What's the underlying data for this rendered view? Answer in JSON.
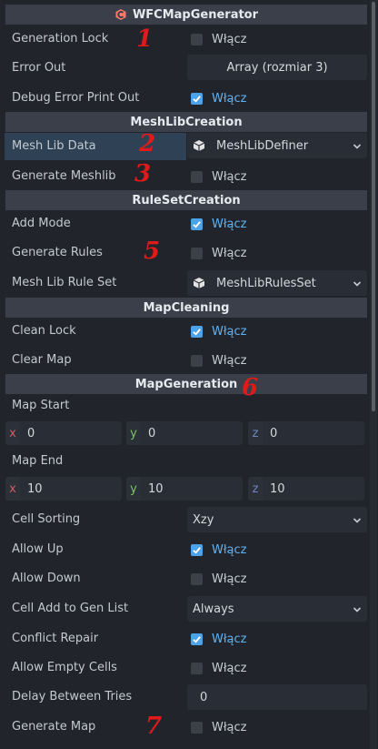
{
  "sections": {
    "main": "WFCMapGenerator",
    "meshlib": "MeshLibCreation",
    "ruleset": "RuleSetCreation",
    "mapcleaning": "MapCleaning",
    "mapgeneration": "MapGeneration"
  },
  "checkbox_text": "Włącz",
  "props": {
    "generation_lock": {
      "label": "Generation Lock",
      "checked": false
    },
    "error_out": {
      "label": "Error Out",
      "value": "Array (rozmiar 3)"
    },
    "debug_error_print_out": {
      "label": "Debug Error Print Out",
      "checked": true
    },
    "mesh_lib_data": {
      "label": "Mesh Lib Data",
      "value": "MeshLibDefiner"
    },
    "generate_meshlib": {
      "label": "Generate Meshlib",
      "checked": false
    },
    "add_mode": {
      "label": "Add Mode",
      "checked": true
    },
    "generate_rules": {
      "label": "Generate Rules",
      "checked": false
    },
    "mesh_lib_rule_set": {
      "label": "Mesh Lib Rule Set",
      "value": "MeshLibRulesSet"
    },
    "clean_lock": {
      "label": "Clean Lock",
      "checked": true
    },
    "clear_map": {
      "label": "Clear Map",
      "checked": false
    },
    "map_start": {
      "label": "Map Start",
      "x": "0",
      "y": "0",
      "z": "0"
    },
    "map_end": {
      "label": "Map End",
      "x": "10",
      "y": "10",
      "z": "10"
    },
    "cell_sorting": {
      "label": "Cell Sorting",
      "value": "Xzy"
    },
    "allow_up": {
      "label": "Allow Up",
      "checked": true
    },
    "allow_down": {
      "label": "Allow Down",
      "checked": false
    },
    "cell_add_to_gen_list": {
      "label": "Cell Add to Gen List",
      "value": "Always"
    },
    "conflict_repair": {
      "label": "Conflict Repair",
      "checked": true
    },
    "allow_empty_cells": {
      "label": "Allow Empty Cells",
      "checked": false
    },
    "delay_between_tries": {
      "label": "Delay Between Tries",
      "value": "0"
    },
    "generate_map": {
      "label": "Generate Map",
      "checked": false
    }
  },
  "axes": {
    "x": "x",
    "y": "y",
    "z": "z"
  },
  "annotations": [
    "1",
    "2",
    "3",
    "5",
    "6",
    "7"
  ],
  "colors": {
    "accent": "#4ea3e8",
    "background": "#21252b",
    "header": "#3a3f49",
    "annotation": "#e01a1a"
  }
}
